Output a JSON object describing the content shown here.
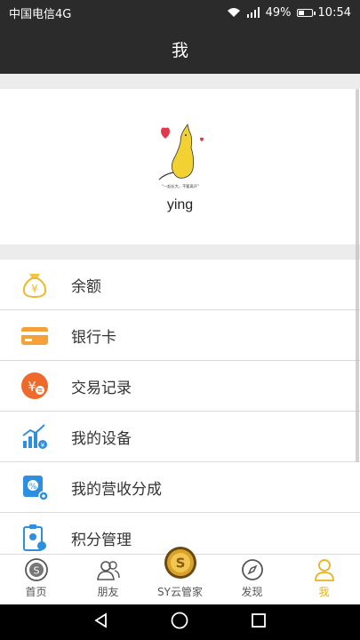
{
  "status_bar": {
    "carrier": "中国电信4G",
    "battery": "49%",
    "battery_level": 0.49,
    "time": "10:54",
    "network": "4G"
  },
  "header": {
    "title": "我"
  },
  "profile": {
    "username": "ying",
    "avatar_caption": "\"一起长大，不要离开\""
  },
  "menu": {
    "items": [
      {
        "label": "余额",
        "icon": "money-bag-icon"
      },
      {
        "label": "银行卡",
        "icon": "bank-card-icon"
      },
      {
        "label": "交易记录",
        "icon": "transaction-record-icon"
      },
      {
        "label": "我的设备",
        "icon": "device-chart-icon"
      },
      {
        "label": "我的营收分成",
        "icon": "revenue-share-icon"
      },
      {
        "label": "积分管理",
        "icon": "points-icon"
      }
    ]
  },
  "tabbar": {
    "tabs": [
      {
        "label": "首页",
        "icon": "home-s-icon"
      },
      {
        "label": "朋友",
        "icon": "friends-icon"
      },
      {
        "label": "SY云管家",
        "icon": "sy-coin-icon"
      },
      {
        "label": "发现",
        "icon": "compass-icon"
      },
      {
        "label": "我",
        "icon": "profile-icon"
      }
    ],
    "active": "我"
  },
  "colors": {
    "header_bg": "#2b2b2b",
    "accent": "#e9b21b",
    "separator": "#ececec"
  }
}
